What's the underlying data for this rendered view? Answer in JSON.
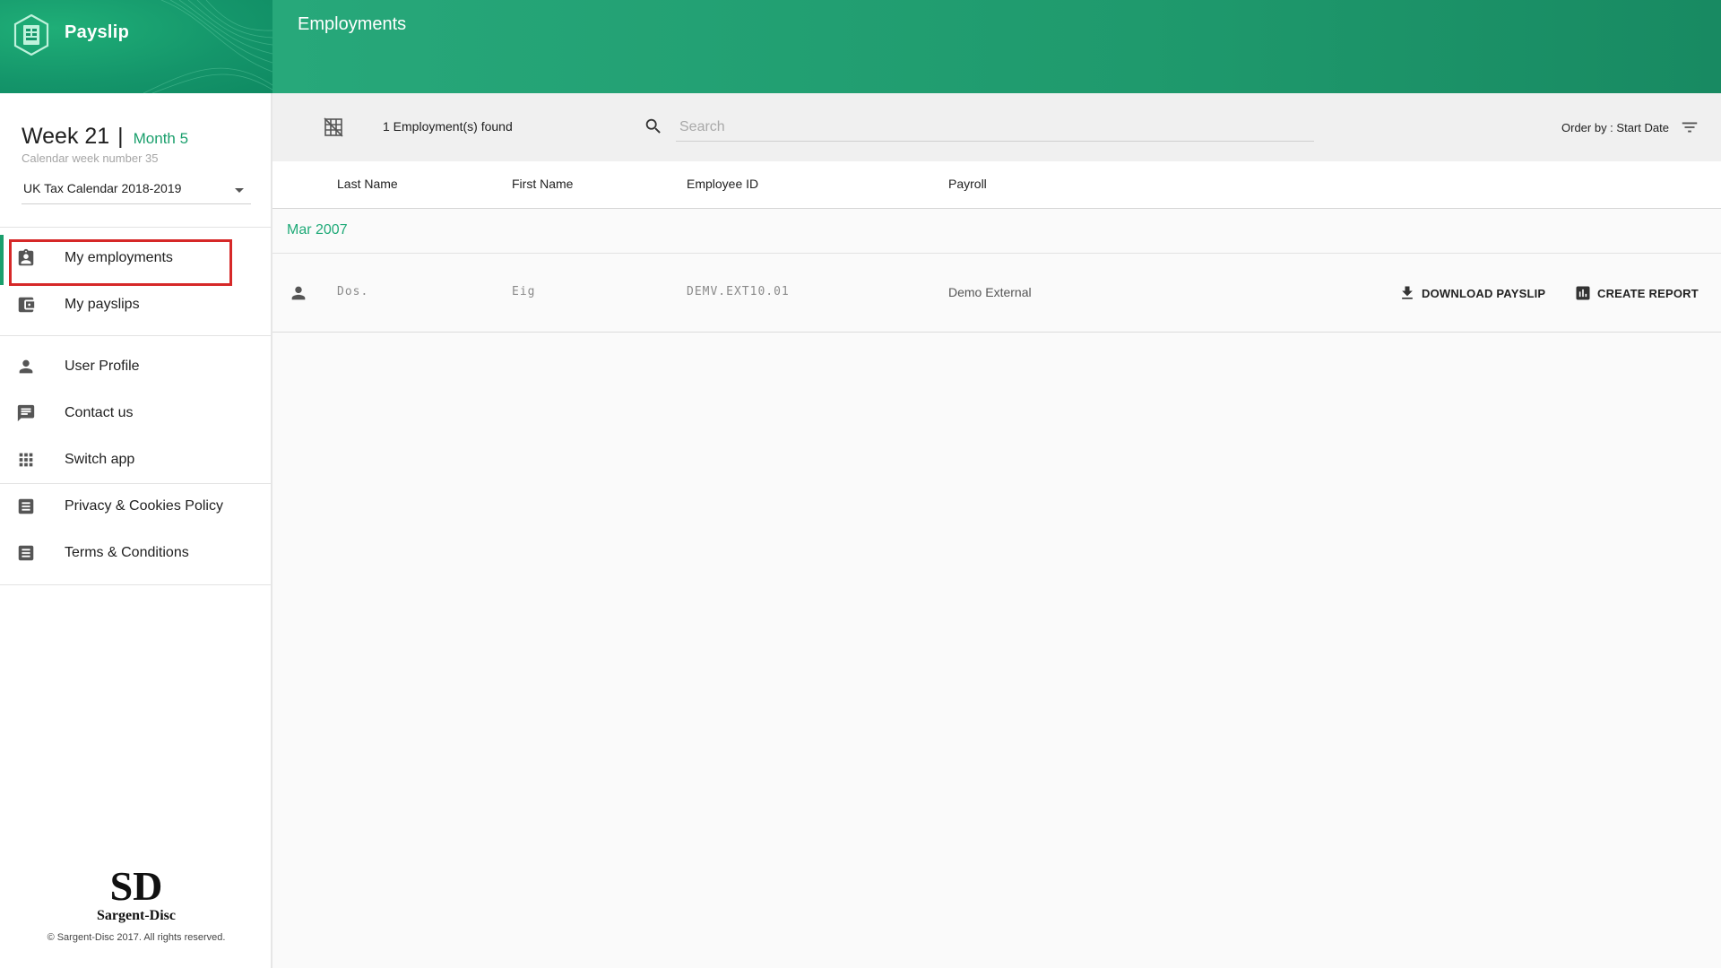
{
  "app": {
    "name": "Payslip",
    "page_title": "Employments"
  },
  "calendar": {
    "week": "Week 21",
    "separator": "|",
    "month": "Month 5",
    "calendar_week": "Calendar week number 35",
    "tax_calendar": "UK Tax Calendar 2018-2019"
  },
  "sidebar": {
    "nav": [
      {
        "label": "My employments",
        "icon": "badge-icon"
      },
      {
        "label": "My payslips",
        "icon": "wallet-icon"
      }
    ],
    "secondary": [
      {
        "label": "User Profile",
        "icon": "person-icon"
      },
      {
        "label": "Contact us",
        "icon": "chat-icon"
      },
      {
        "label": "Switch app",
        "icon": "apps-grid-icon"
      }
    ],
    "legal": [
      {
        "label": "Privacy & Cookies Policy",
        "icon": "document-icon"
      },
      {
        "label": "Terms & Conditions",
        "icon": "document-icon"
      }
    ],
    "footer": {
      "company": "Sargent-Disc",
      "logo_letters": "SD",
      "copyright": "© Sargent-Disc 2017. All rights reserved."
    }
  },
  "toolbar": {
    "count": "1 Employment(s) found",
    "search_placeholder": "Search",
    "order_by": "Order by : Start Date"
  },
  "table": {
    "columns": [
      "Last Name",
      "First Name",
      "Employee ID",
      "Payroll"
    ],
    "groups": [
      {
        "label": "Mar 2007",
        "rows": [
          {
            "last_name": "Dos.",
            "first_name": "Eig",
            "employee_id": "DEMV.EXT10.01",
            "payroll": "Demo External"
          }
        ]
      }
    ],
    "actions": {
      "download": "DOWNLOAD PAYSLIP",
      "report": "CREATE REPORT"
    }
  },
  "colors": {
    "brand_green": "#1a9f6c",
    "highlight_red": "#d62828"
  }
}
